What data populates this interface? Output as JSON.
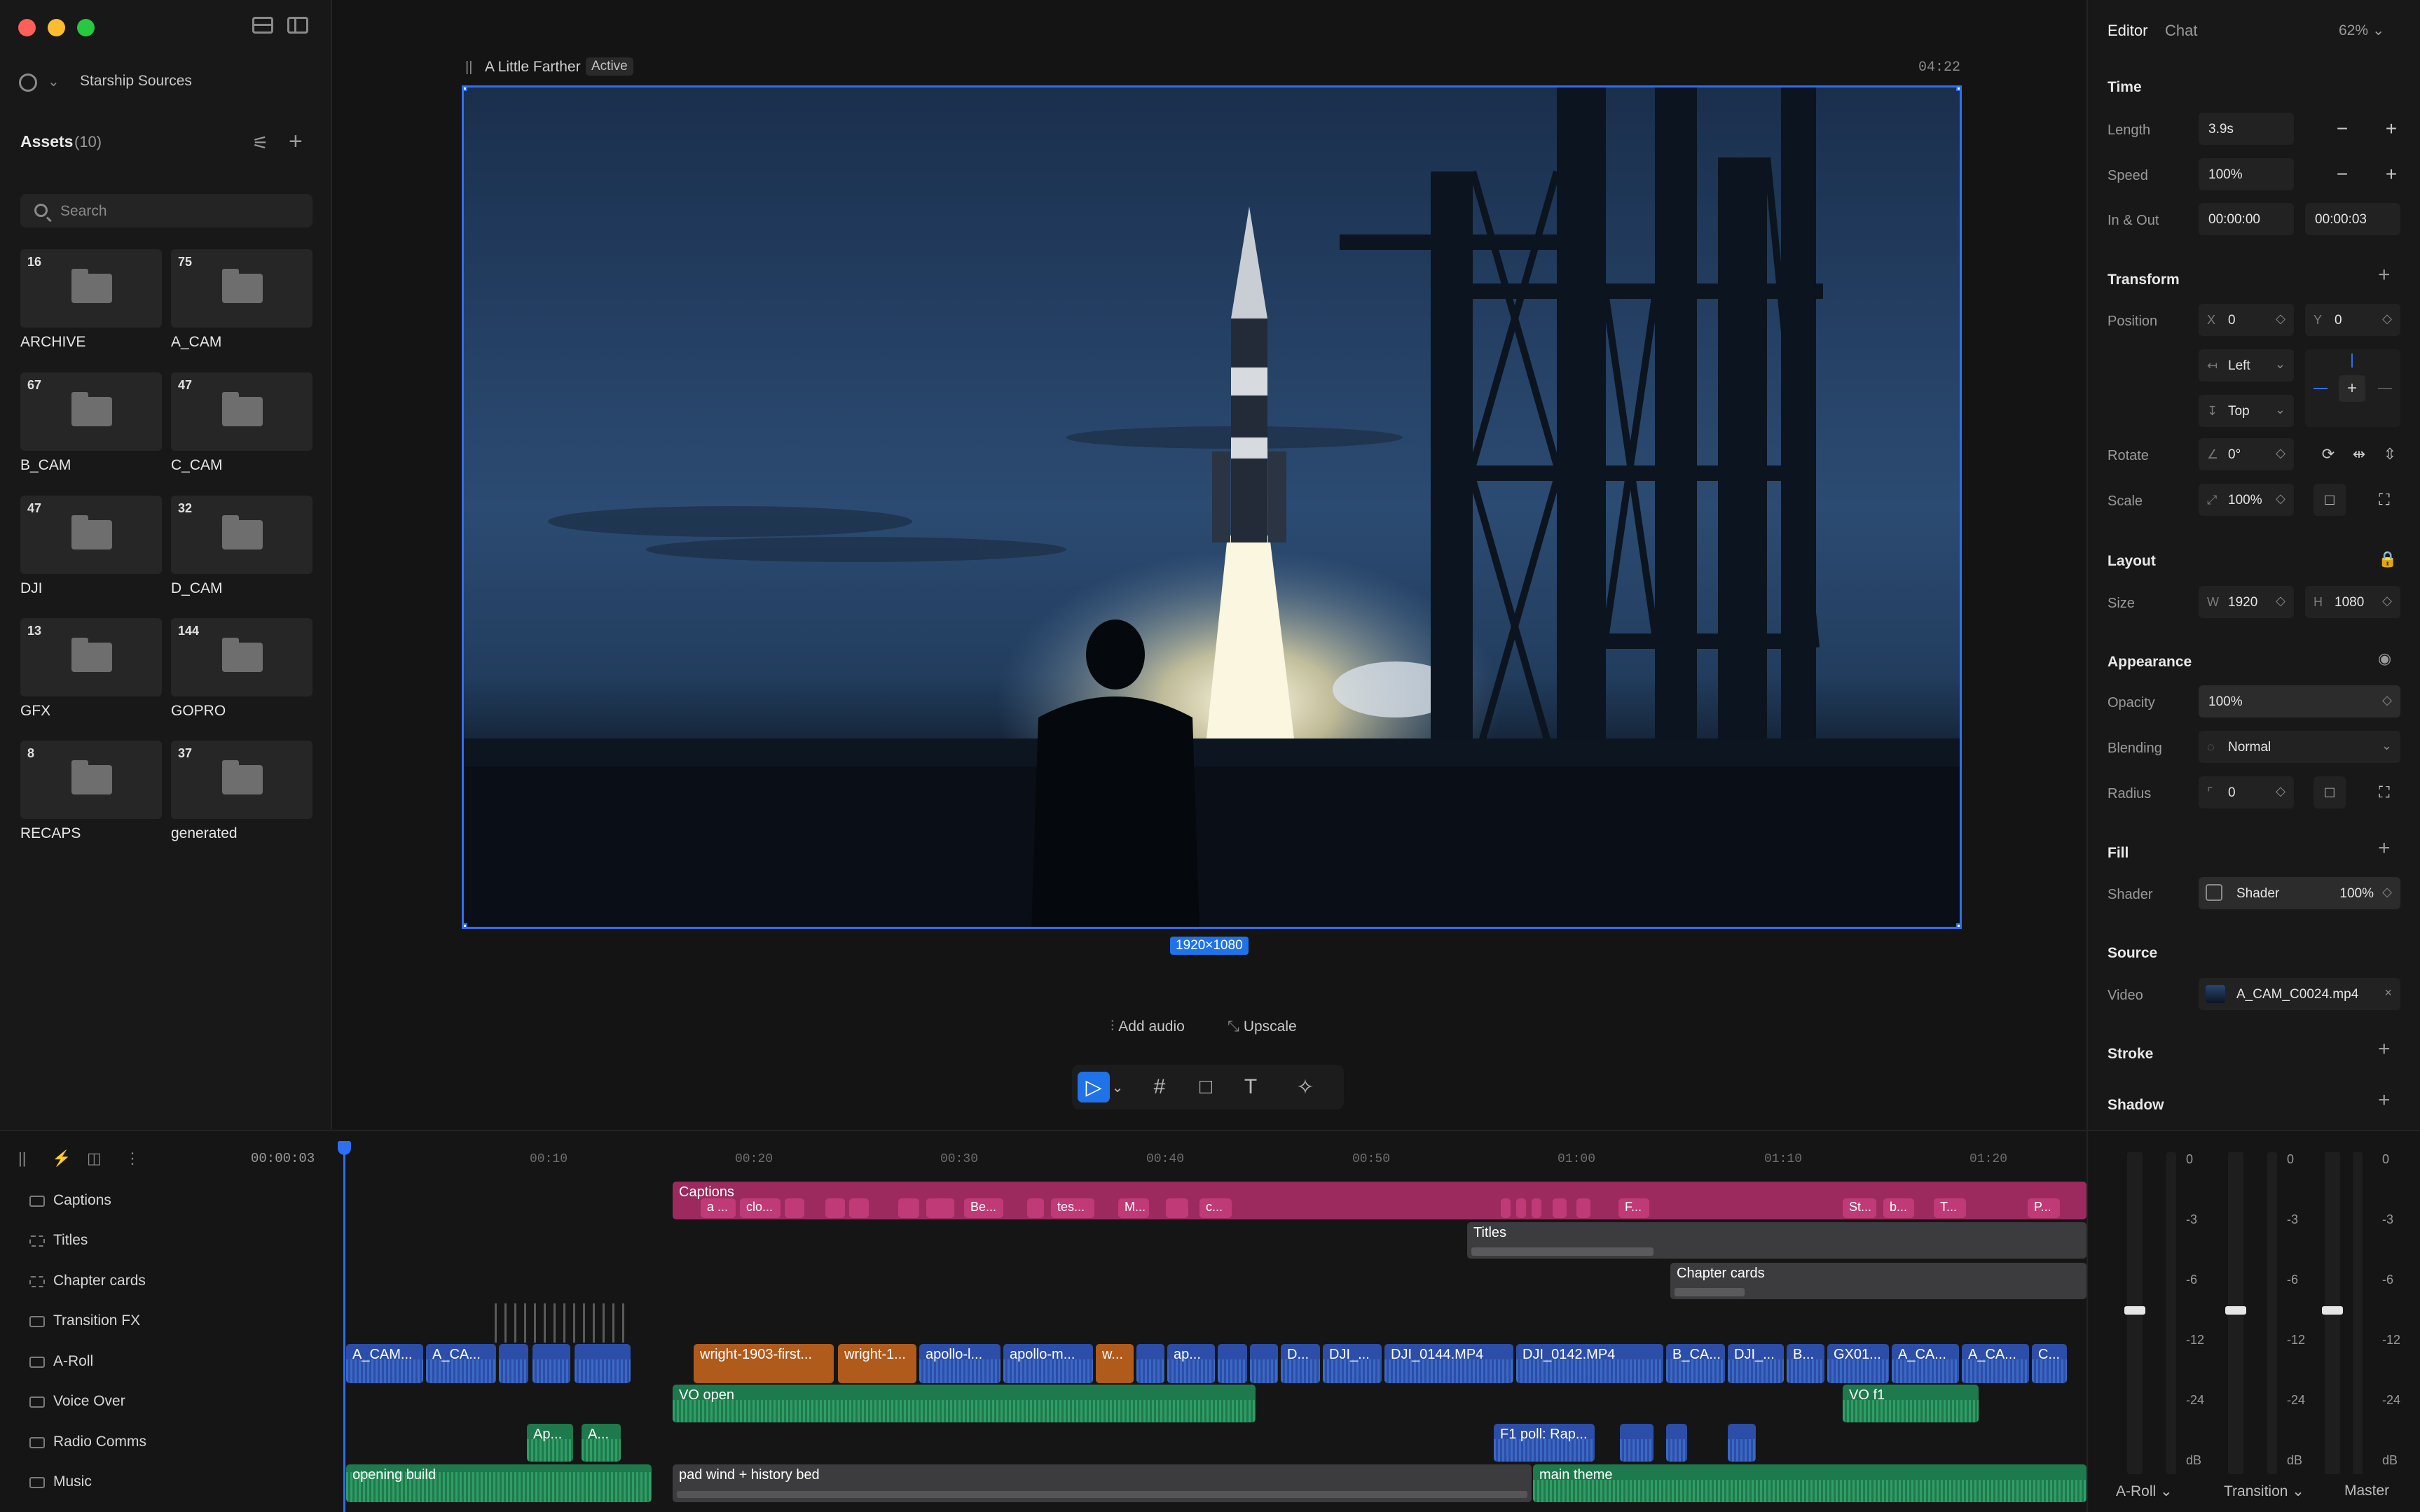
{
  "window": {
    "workspace": "Starship Sources"
  },
  "assets": {
    "title": "Assets",
    "count": "(10)",
    "search_placeholder": "Search",
    "folders": [
      {
        "count": "16",
        "name": "ARCHIVE"
      },
      {
        "count": "75",
        "name": "A_CAM"
      },
      {
        "count": "67",
        "name": "B_CAM"
      },
      {
        "count": "47",
        "name": "C_CAM"
      },
      {
        "count": "47",
        "name": "DJI"
      },
      {
        "count": "32",
        "name": "D_CAM"
      },
      {
        "count": "13",
        "name": "GFX"
      },
      {
        "count": "144",
        "name": "GOPRO"
      },
      {
        "count": "8",
        "name": "RECAPS"
      },
      {
        "count": "37",
        "name": "generated"
      }
    ]
  },
  "preview": {
    "clip_name": "A Little Farther",
    "clip_status": "Active",
    "duration": "04:22",
    "dimensions": "1920×1080",
    "add_audio": "Add audio",
    "upscale": "Upscale"
  },
  "timeline": {
    "timecode": "00:00:03",
    "ruler": [
      "00:10",
      "00:20",
      "00:30",
      "00:40",
      "00:50",
      "01:00",
      "01:10",
      "01:20"
    ],
    "tracks": [
      "Captions",
      "Titles",
      "Chapter cards",
      "Transition FX",
      "A-Roll",
      "Voice Over",
      "Radio Comms",
      "Music"
    ],
    "clips": {
      "captions": "Captions",
      "captions_items": [
        "a ...",
        "clo...",
        "Be...",
        "tes...",
        "M...",
        "c...",
        "F...",
        "St...",
        "b...",
        "T...",
        "P..."
      ],
      "titles": "Titles",
      "chapter_cards": "Chapter cards",
      "aroll": [
        "A_CAM...",
        "A_CA...",
        "wright-1903-first...",
        "wright-1...",
        "apollo-l...",
        "apollo-m...",
        "w...",
        "ap...",
        "D...",
        "DJI_...",
        "DJI_0144.MP4",
        "DJI_0142.MP4",
        "B_CA...",
        "DJI_...",
        "B...",
        "GX01...",
        "A_CA...",
        "A_CA...",
        "C..."
      ],
      "vo": [
        "VO open",
        "VO f1"
      ],
      "radio": [
        "Ap...",
        "A...",
        "F1 poll: Rap..."
      ],
      "music": [
        "opening build",
        "pad wind + history bed",
        "main theme"
      ]
    }
  },
  "inspector": {
    "tabs": [
      "Editor",
      "Chat"
    ],
    "zoom": "62%",
    "time": {
      "title": "Time",
      "length_label": "Length",
      "length": "3.9s",
      "speed_label": "Speed",
      "speed": "100%",
      "inout_label": "In & Out",
      "in": "00:00:00",
      "out": "00:00:03"
    },
    "transform": {
      "title": "Transform",
      "position_label": "Position",
      "x_label": "X",
      "x": "0",
      "y_label": "Y",
      "y": "0",
      "h_align": "Left",
      "v_align": "Top",
      "rotate_label": "Rotate",
      "rotate": "0°",
      "scale_label": "Scale",
      "scale": "100%"
    },
    "layout": {
      "title": "Layout",
      "size_label": "Size",
      "w_label": "W",
      "w": "1920",
      "h_label": "H",
      "h": "1080"
    },
    "appearance": {
      "title": "Appearance",
      "opacity_label": "Opacity",
      "opacity": "100%",
      "blending_label": "Blending",
      "blending": "Normal",
      "radius_label": "Radius",
      "radius": "0"
    },
    "fill": {
      "title": "Fill",
      "shader_label": "Shader",
      "shader": "Shader",
      "shader_value": "100%"
    },
    "source": {
      "title": "Source",
      "video_label": "Video",
      "video": "A_CAM_C0024.mp4"
    },
    "stroke": {
      "title": "Stroke"
    },
    "shadow": {
      "title": "Shadow"
    }
  },
  "mixer": {
    "scale": [
      "0",
      "-3",
      "-6",
      "-12",
      "-24",
      "dB"
    ],
    "channels": [
      "A-Roll",
      "Transition",
      "Master"
    ]
  }
}
